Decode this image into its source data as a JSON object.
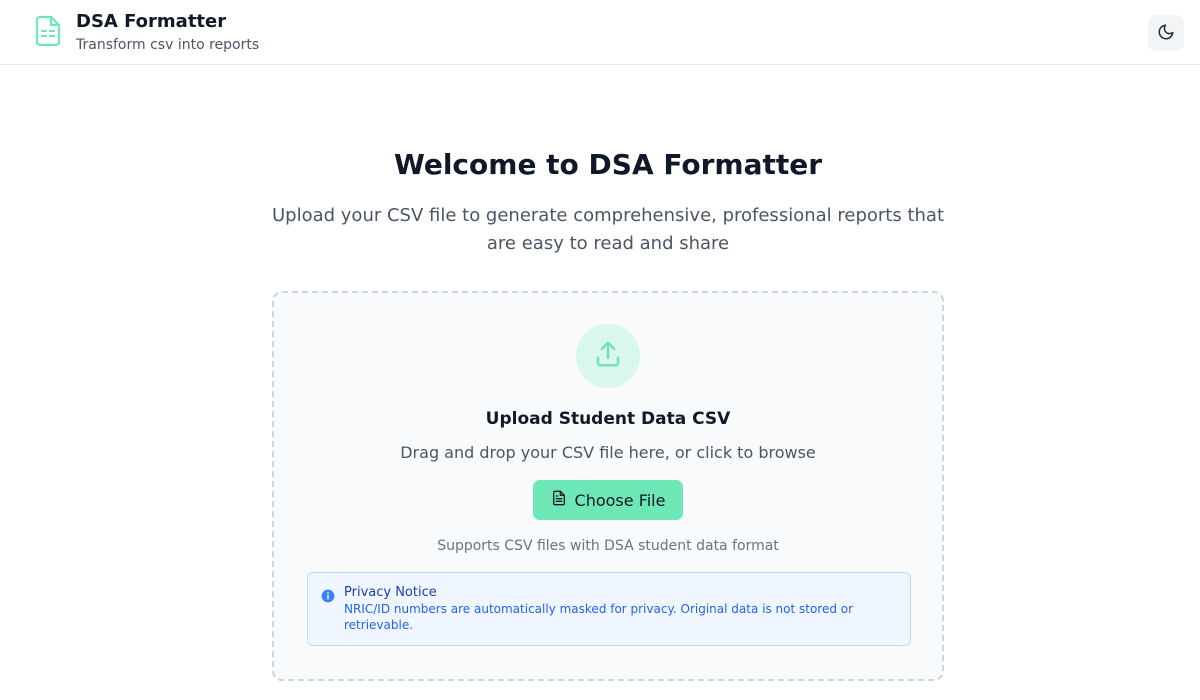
{
  "header": {
    "title": "DSA Formatter",
    "subtitle": "Transform csv into reports",
    "logo_icon": "spreadsheet-file-icon",
    "theme_toggle_icon": "moon-icon"
  },
  "hero": {
    "title": "Welcome to DSA Formatter",
    "description": "Upload your CSV file to generate comprehensive, professional reports that are easy to read and share"
  },
  "upload": {
    "icon": "upload-icon",
    "title": "Upload Student Data CSV",
    "description": "Drag and drop your CSV file here, or click to browse",
    "button_label": "Choose File",
    "button_icon": "file-text-icon",
    "supports": "Supports CSV files with DSA student data format"
  },
  "privacy": {
    "icon": "info-icon",
    "title": "Privacy Notice",
    "text": "NRIC/ID numbers are automatically masked for privacy. Original data is not stored or retrievable."
  },
  "colors": {
    "accent": "#6ee7b7",
    "accent_light": "#d9f7ec",
    "notice_bg": "#eff6ff",
    "notice_text": "#2563eb"
  }
}
